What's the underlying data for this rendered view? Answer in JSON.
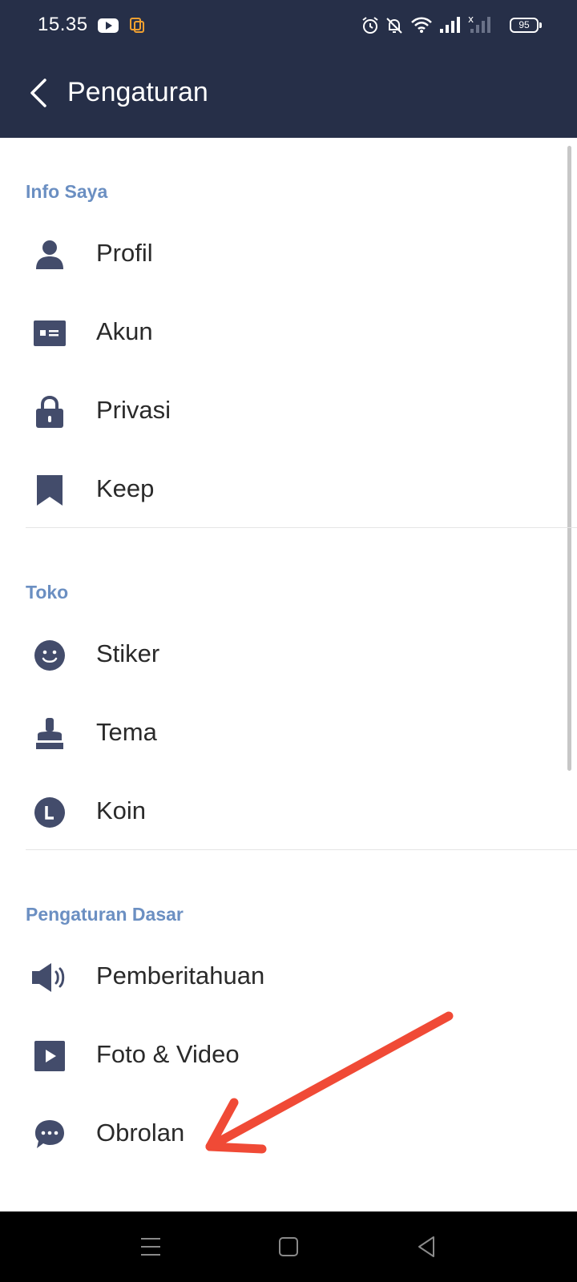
{
  "status_bar": {
    "time": "15.35",
    "battery": "95",
    "icons": [
      "youtube-icon",
      "screen-record-icon",
      "alarm-icon",
      "mute-icon",
      "wifi-icon",
      "signal-icon",
      "signal-no-service-icon",
      "battery-icon"
    ]
  },
  "header": {
    "title": "Pengaturan",
    "back_icon": "chevron-left-icon"
  },
  "sections": [
    {
      "title": "Info Saya",
      "items": [
        {
          "label": "Profil",
          "icon": "profile-icon"
        },
        {
          "label": "Akun",
          "icon": "account-card-icon"
        },
        {
          "label": "Privasi",
          "icon": "lock-icon"
        },
        {
          "label": "Keep",
          "icon": "bookmark-icon"
        }
      ]
    },
    {
      "title": "Toko",
      "items": [
        {
          "label": "Stiker",
          "icon": "smiley-icon"
        },
        {
          "label": "Tema",
          "icon": "brush-icon"
        },
        {
          "label": "Koin",
          "icon": "coin-icon"
        }
      ]
    },
    {
      "title": "Pengaturan Dasar",
      "items": [
        {
          "label": "Pemberitahuan",
          "icon": "speaker-icon"
        },
        {
          "label": "Foto & Video",
          "icon": "play-icon"
        },
        {
          "label": "Obrolan",
          "icon": "chat-bubble-icon"
        }
      ]
    }
  ],
  "annotation": {
    "color": "#f04a36",
    "icon": "red-arrow-icon"
  },
  "nav_bar": {
    "icons": [
      "menu-icon",
      "home-square-icon",
      "back-triangle-icon"
    ]
  },
  "colors": {
    "header_bg": "#262f48",
    "section_title": "#6b8fc2",
    "icon": "#434c6b",
    "text": "#2a2a2a"
  }
}
